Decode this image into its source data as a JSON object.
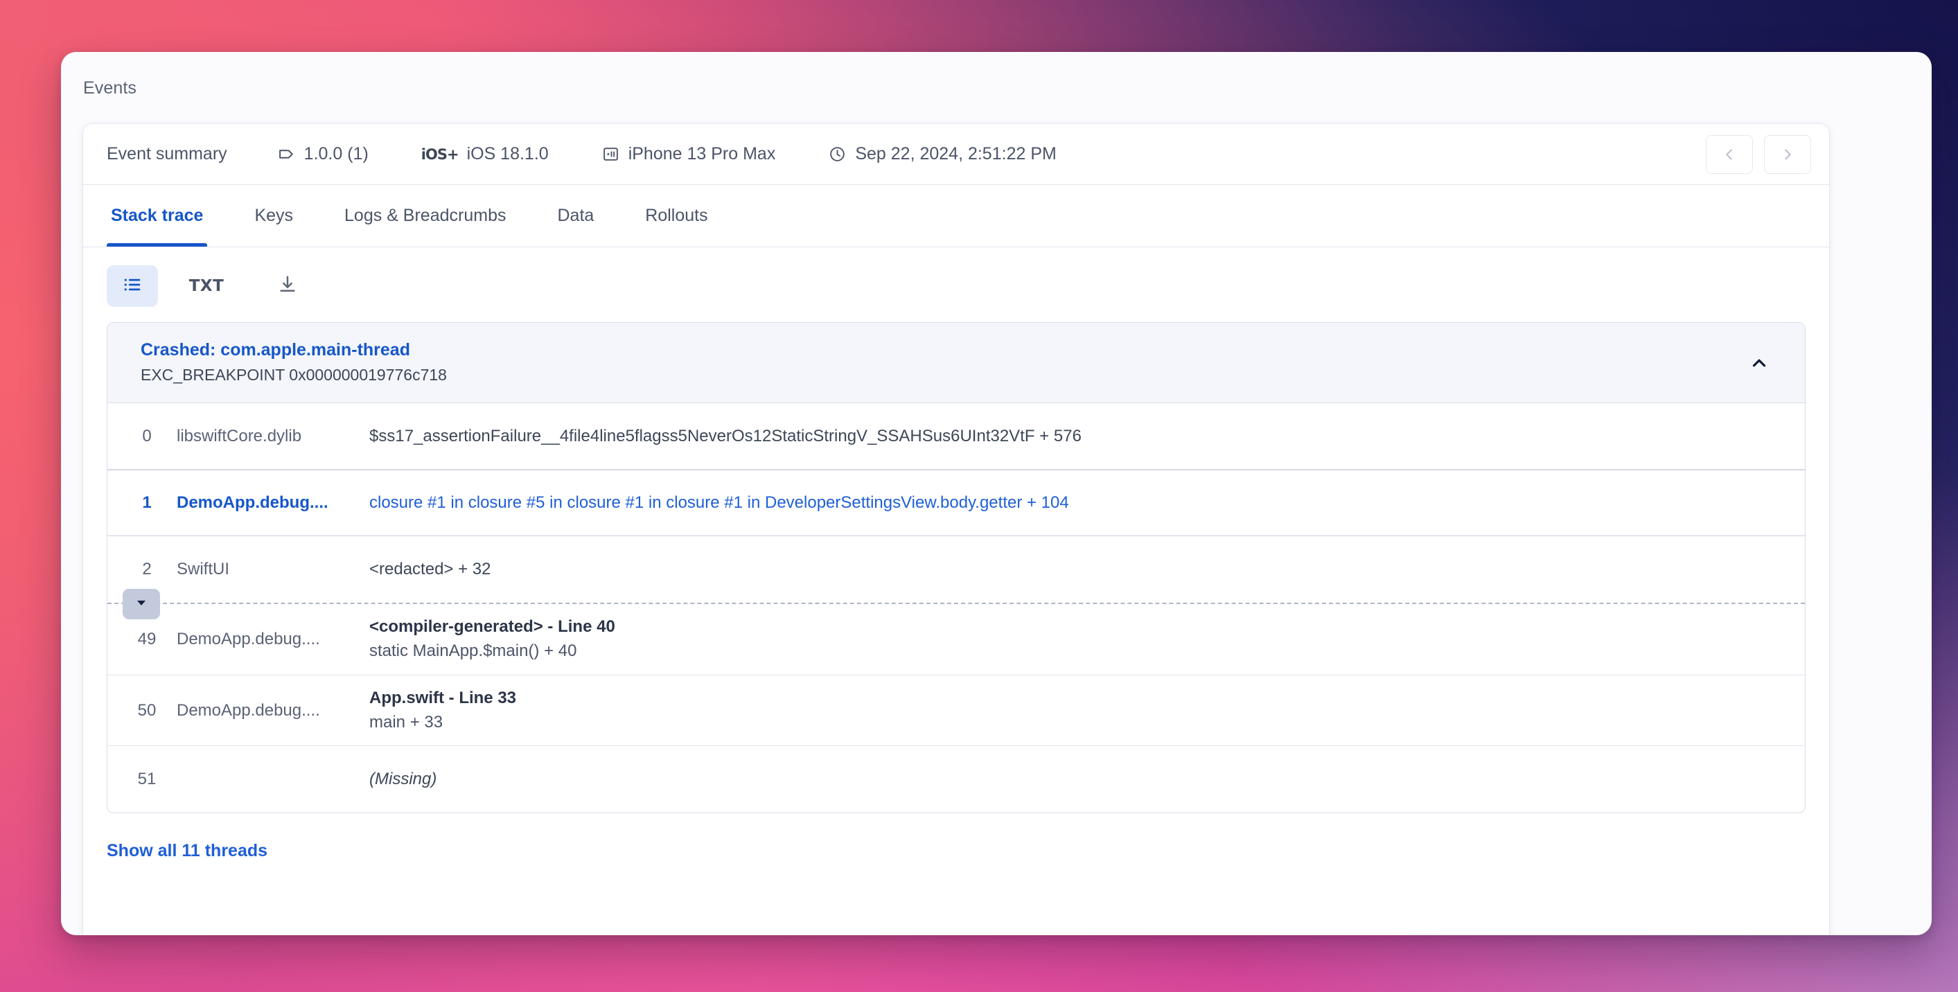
{
  "panel": {
    "title": "Events"
  },
  "summary": {
    "label": "Event summary",
    "chips": [
      {
        "icon": "tag-icon",
        "text": "1.0.0 (1)"
      },
      {
        "icon": "ios-icon",
        "text": "iOS 18.1.0"
      },
      {
        "icon": "device-icon",
        "text": "iPhone 13 Pro Max"
      },
      {
        "icon": "clock-icon",
        "text": "Sep 22, 2024, 2:51:22 PM"
      }
    ],
    "nav": {
      "prev": "‹",
      "next": "›"
    }
  },
  "tabs": [
    {
      "label": "Stack trace",
      "active": true
    },
    {
      "label": "Keys",
      "active": false
    },
    {
      "label": "Logs & Breadcrumbs",
      "active": false
    },
    {
      "label": "Data",
      "active": false
    },
    {
      "label": "Rollouts",
      "active": false
    }
  ],
  "toolbar": {
    "list_view": "list-view-icon",
    "txt_label": "TXT",
    "download": "download-icon"
  },
  "thread": {
    "title": "Crashed: com.apple.main-thread",
    "subtitle": "EXC_BREAKPOINT 0x000000019776c718",
    "collapse_icon": "chevron-up-icon"
  },
  "frames_top": [
    {
      "index": "0",
      "library": "libswiftCore.dylib",
      "symbol": "$ss17_assertionFailure__4file4line5flagss5NeverOs12StaticStringV_SSAHSus6UInt32VtF + 576",
      "highlight": false
    },
    {
      "index": "1",
      "library": "DemoApp.debug....",
      "symbol": "closure #1 in closure #5 in closure #1 in closure #1 in DeveloperSettingsView.body.getter + 104",
      "highlight": true
    },
    {
      "index": "2",
      "library": "SwiftUI",
      "symbol": "<redacted> + 32",
      "highlight": false
    }
  ],
  "expander": {
    "icon": "chevron-down-icon"
  },
  "frames_bottom": [
    {
      "index": "49",
      "library": "DemoApp.debug....",
      "symbol_top": "<compiler-generated> - Line 40",
      "symbol_sub": "static MainApp.$main() + 40"
    },
    {
      "index": "50",
      "library": "DemoApp.debug....",
      "symbol_top": "App.swift - Line 33",
      "symbol_sub": "main + 33"
    },
    {
      "index": "51",
      "library": "",
      "symbol_missing": "(Missing)"
    }
  ],
  "footer": {
    "show_threads": "Show all 11 threads"
  },
  "colors": {
    "accent": "#1657c8",
    "link": "#1f5fd6",
    "text": "#3d4657",
    "muted": "#5a6275",
    "border": "#d9dde7",
    "header_bg": "#f4f6fb"
  }
}
